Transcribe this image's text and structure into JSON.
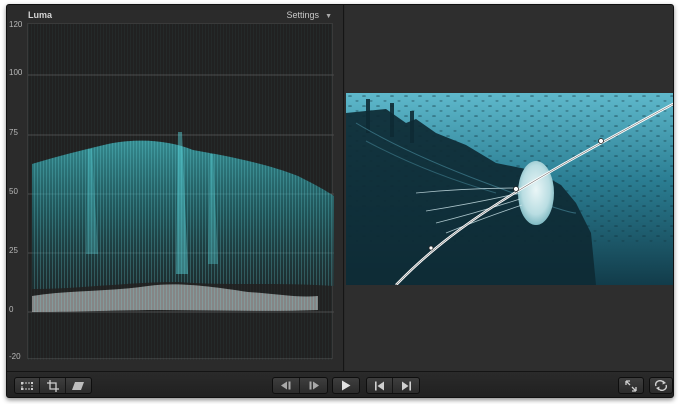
{
  "scope": {
    "title": "Luma",
    "settings_label": "Settings",
    "settings_caret": "▼",
    "axis_ticks": [
      "120",
      "100",
      "75",
      "50",
      "25",
      "0",
      "-20"
    ]
  },
  "viewer": {
    "content": "underwater-shipwreck-jellyfish-with-curve-overlay"
  },
  "toolbar": {
    "left_tools": [
      "transform-icon",
      "crop-icon",
      "distort-icon"
    ],
    "transport": [
      "previous-frame-icon",
      "next-frame-icon",
      "play-icon",
      "go-to-start-icon",
      "go-to-end-icon"
    ],
    "right_tools": [
      "fullscreen-icon",
      "loop-icon"
    ]
  },
  "colors": {
    "window_bg": "#2a2a2a",
    "scope_bg": "#212121",
    "luma_trace": "#2bb0b8",
    "luma_low": "#c9c9c9",
    "video_water": "#1c4a5a"
  }
}
